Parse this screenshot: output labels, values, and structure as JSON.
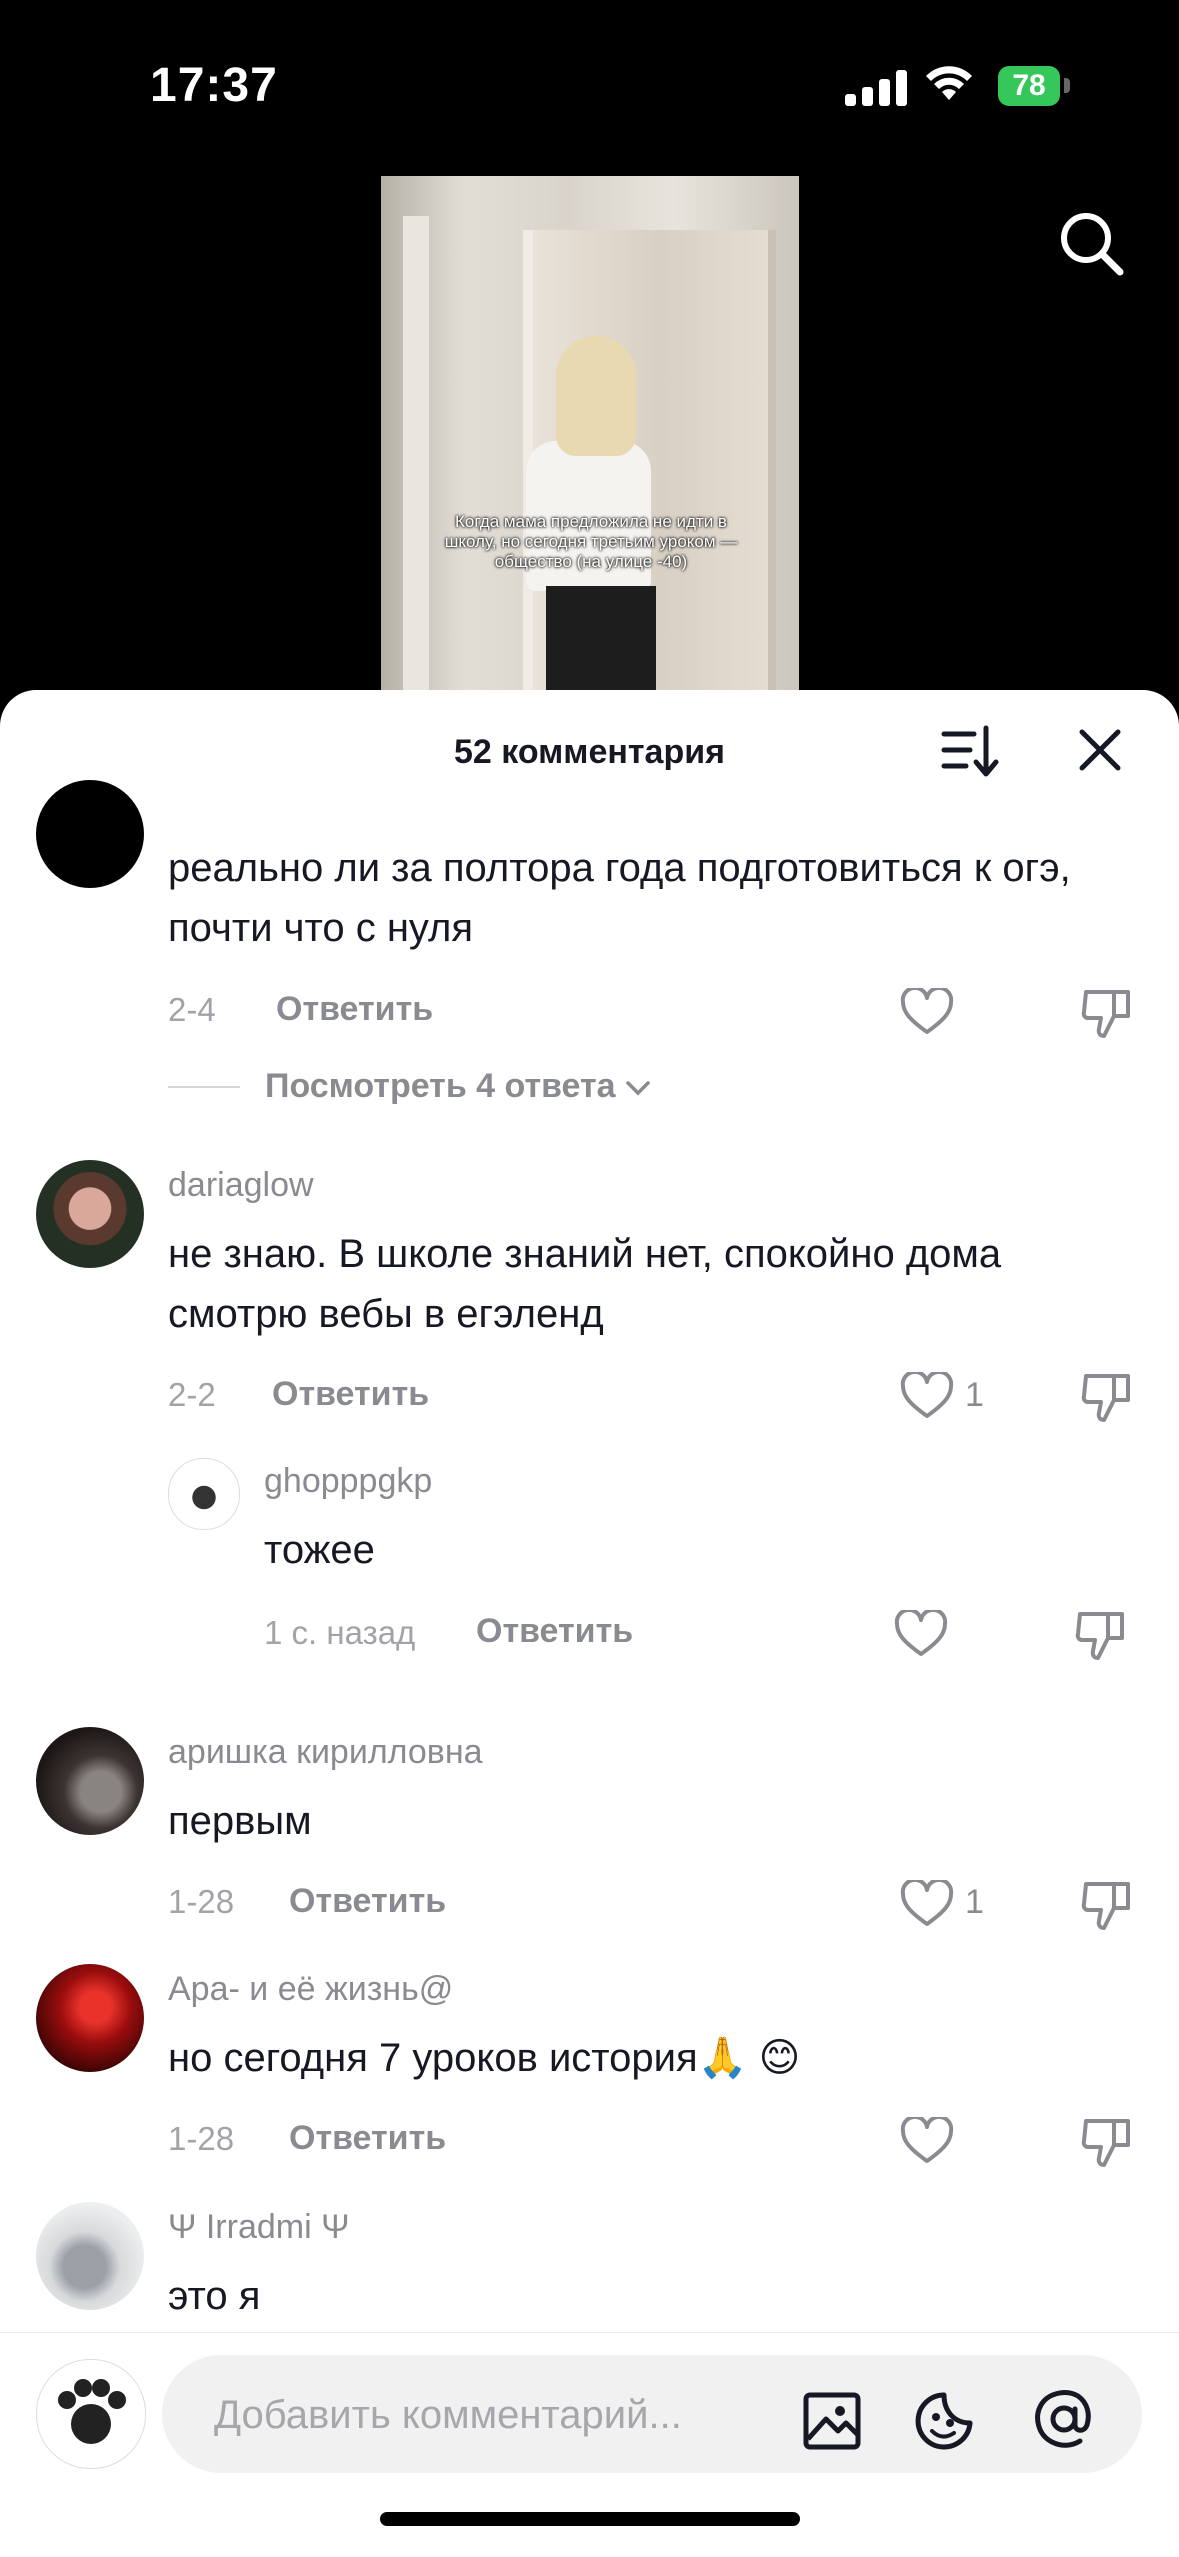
{
  "status_bar": {
    "time": "17:37",
    "battery": "78"
  },
  "video": {
    "caption": "Когда мама предложила не идти в школу, но сегодня третьим уроком — общество (на улице -40)"
  },
  "comments_sheet": {
    "title": "52 комментария",
    "reply_label": "Ответить",
    "comments": [
      {
        "username": "",
        "text": "реально ли за полтора года подготовиться к огэ, почти что с нуля",
        "date": "2-4",
        "likes": "",
        "view_replies": "Посмотреть 4 ответа"
      },
      {
        "username": "dariaglow",
        "text": "не знаю. В школе знаний нет, спокойно дома смотрю вебы в егэленд",
        "date": "2-2",
        "likes": "1",
        "replies": [
          {
            "username": "ghopppgkp",
            "text": "тожее",
            "date": "1 с. назад"
          }
        ]
      },
      {
        "username": "аришка кирилловна",
        "text": "первым",
        "date": "1-28",
        "likes": "1"
      },
      {
        "username": "Ара- и её жизнь@",
        "text": "но сегодня 7 уроков история🙏 😊",
        "date": "1-28",
        "likes": ""
      },
      {
        "username": "Ψ Irradmi Ψ",
        "text": "это я"
      }
    ]
  },
  "input_bar": {
    "placeholder": "Добавить комментарий..."
  },
  "icons": {
    "search": "search-icon",
    "sort": "sort-icon",
    "close": "close-icon",
    "heart": "heart-icon",
    "dislike": "dislike-icon",
    "image": "image-icon",
    "emoji": "emoji-icon",
    "mention": "at-icon"
  }
}
